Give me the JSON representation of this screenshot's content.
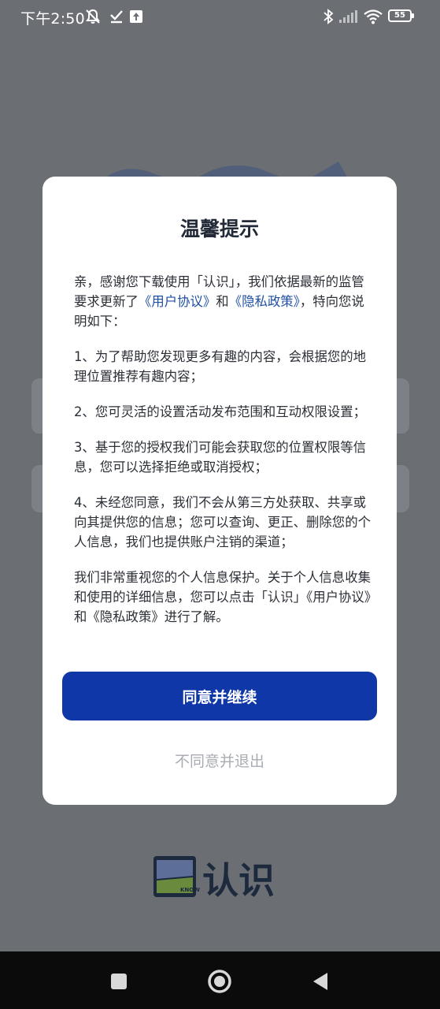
{
  "status_bar": {
    "time": "下午2:50",
    "battery": "55"
  },
  "dialog": {
    "title": "温馨提示",
    "intro": {
      "part1": "亲，感谢您下载使用「认识」，我们依据最新的监管要求更新了",
      "link_user_agreement": "《用户协议》",
      "and": "和",
      "link_privacy_policy": "《隐私政策》",
      "part2": "，特向您说明如下："
    },
    "items": [
      "1、为了帮助您发现更多有趣的内容，会根据您的地理位置推荐有趣内容；",
      "2、您可灵活的设置活动发布范围和互动权限设置；",
      "3、基于您的授权我们可能会获取您的位置权限等信息，您可以选择拒绝或取消授权；",
      "4、未经您同意，我们不会从第三方处获取、共享或向其提供您的信息；您可以查询、更正、删除您的个人信息，我们也提供账户注销的渠道；"
    ],
    "closing": " 我们非常重视您的个人信息保护。关于个人信息收集和使用的详细信息，您可以点击「认识」《用户协议》和《隐私政策》进行了解。",
    "agree_button": "同意并继续",
    "disagree_button": "不同意并退出"
  },
  "brand": {
    "logo_text": "认识",
    "logo_subtext": "KNOW"
  },
  "colors": {
    "overlay_bg": "#6b6e72",
    "primary": "#1037a8",
    "link": "#1f4fa3",
    "secondary_text": "#a9adb3",
    "nav_bg": "#0b0b0b"
  },
  "icons": {
    "status_left": [
      "mute-bell-icon",
      "check-icon",
      "upload-icon"
    ],
    "status_right": [
      "bluetooth-icon",
      "signal-icon",
      "wifi-icon",
      "battery-icon"
    ],
    "nav": [
      "recent-apps-icon",
      "home-icon",
      "back-icon"
    ]
  }
}
